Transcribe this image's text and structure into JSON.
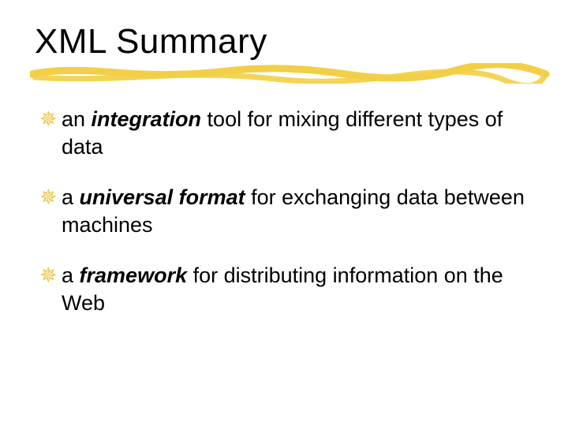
{
  "slide": {
    "title": "XML Summary",
    "bullets": [
      {
        "pre": "an ",
        "em": "integration",
        "post": "  tool for mixing different types of data"
      },
      {
        "pre": "a ",
        "em": "universal format",
        "post": "  for exchanging data between machines"
      },
      {
        "pre": "a ",
        "em": "framework",
        "post": " for distributing information on the Web"
      }
    ],
    "bullet_glyph": "✵",
    "colors": {
      "bullet": "#e6c84a",
      "underline": "#f2cf46"
    }
  }
}
